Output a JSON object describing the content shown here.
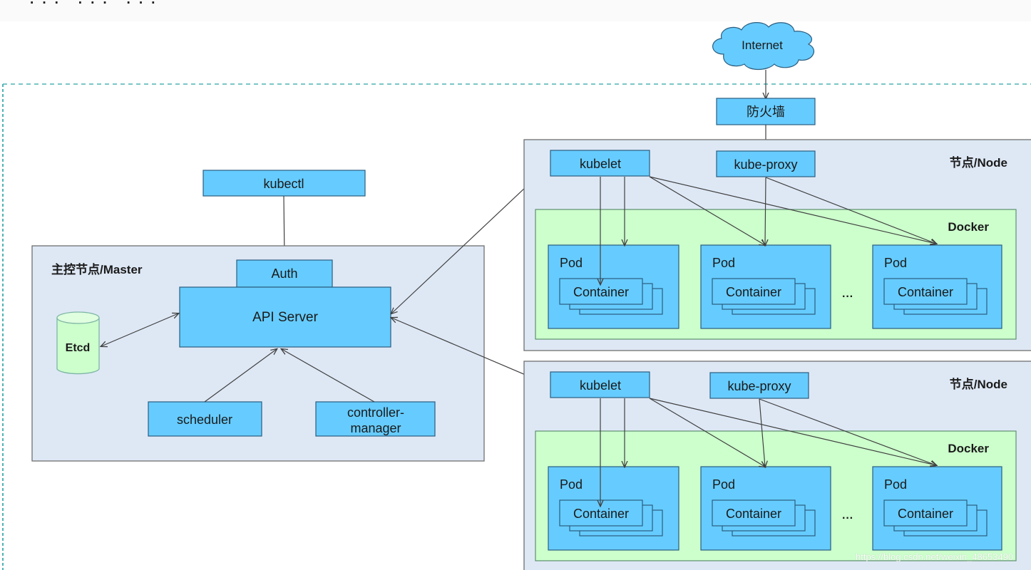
{
  "header": {
    "cut_off_title": "··· ··· ···"
  },
  "colors": {
    "box_fill": "#66ccff",
    "box_stroke": "#2b5d7f",
    "region_fill": "#dee8f5",
    "region_stroke": "#6f6f6f",
    "docker_fill": "#ccffcc",
    "docker_stroke": "#5f8f6f",
    "etcd_fill": "#ccffcc",
    "cluster_border": "#4fb3b3",
    "arrow": "#404040",
    "text": "#1a1a1a"
  },
  "external": {
    "internet_label": "Internet",
    "firewall_label": "防火墙"
  },
  "client": {
    "kubectl_label": "kubectl"
  },
  "master": {
    "title": "主控节点/Master",
    "auth_label": "Auth",
    "api_server_label": "API Server",
    "etcd_label": "Etcd",
    "scheduler_label": "scheduler",
    "controller_manager_line1": "controller-",
    "controller_manager_line2": "manager"
  },
  "nodes": [
    {
      "title": "节点/Node",
      "kubelet_label": "kubelet",
      "kube_proxy_label": "kube-proxy",
      "docker_label": "Docker",
      "pods": [
        {
          "label": "Pod",
          "container_label": "Container"
        },
        {
          "label": "Pod",
          "container_label": "Container"
        },
        {
          "label": "Pod",
          "container_label": "Container"
        }
      ],
      "ellipsis": "···"
    },
    {
      "title": "节点/Node",
      "kubelet_label": "kubelet",
      "kube_proxy_label": "kube-proxy",
      "docker_label": "Docker",
      "pods": [
        {
          "label": "Pod",
          "container_label": "Container"
        },
        {
          "label": "Pod",
          "container_label": "Container"
        },
        {
          "label": "Pod",
          "container_label": "Container"
        }
      ],
      "ellipsis": "···"
    }
  ],
  "watermark": "https://blog.csdn.net/weixin_48653490"
}
